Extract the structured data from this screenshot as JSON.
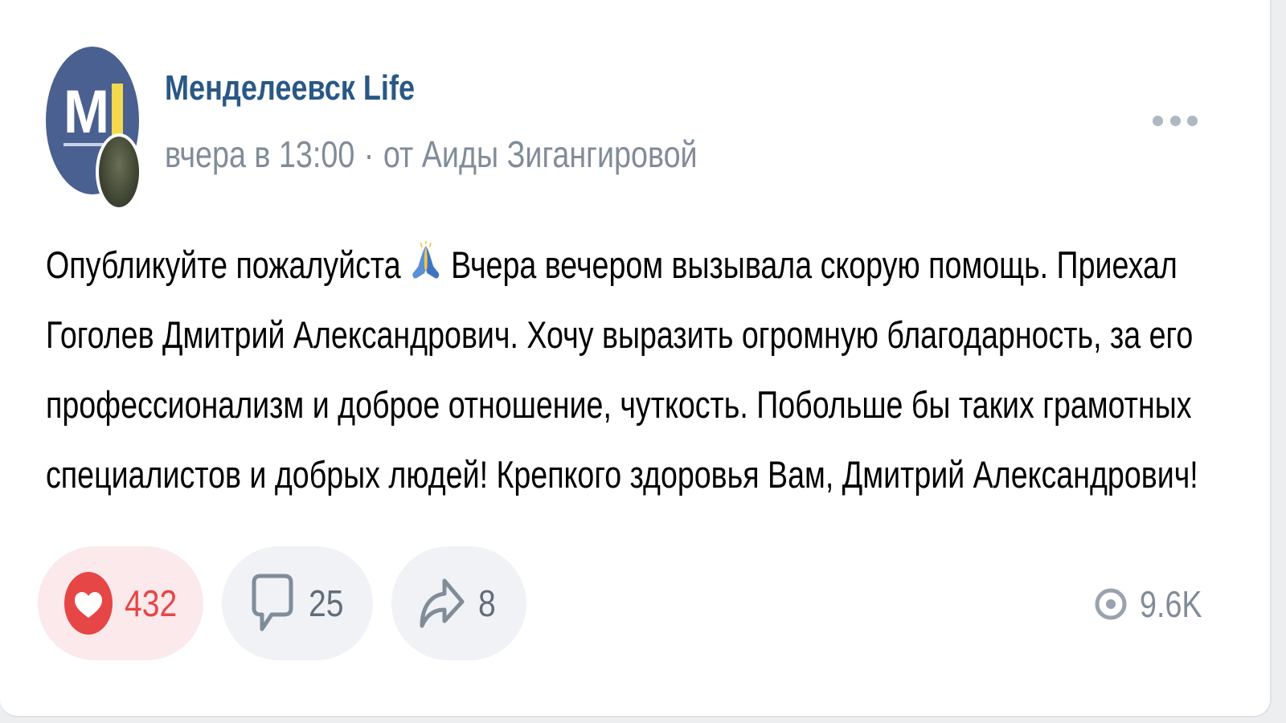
{
  "post": {
    "group_name": "Менделеевск Life",
    "time": "вчера в 13:00",
    "separator": "·",
    "author": "от Аиды Зигангировой",
    "text_lines": [
      "Опубликуйте пожалуйста",
      "Вчера вечером вызывала скорую помощь. Приехал",
      "Гоголев Дмитрий Александрович. Хочу выразить огромную благодарность, за его",
      "профессионализм и доброе отношение, чуткость. Побольше бы таких грамотных",
      "специалистов и добрых людей! Крепкого здоровья Вам, Дмитрий Александрович!"
    ],
    "emoji": "🙏"
  },
  "actions": {
    "likes": "432",
    "comments": "25",
    "shares": "8",
    "views": "9.6K"
  },
  "icons": {
    "like": "heart-icon",
    "comment": "comment-icon",
    "share": "share-icon",
    "views": "eye-icon",
    "more": "more-icon"
  },
  "colors": {
    "group_name": "#2a5885",
    "meta": "#818c99",
    "like_accent": "#e64646",
    "like_bg": "#fbe9ec",
    "action_bg": "#f0f2f5"
  }
}
